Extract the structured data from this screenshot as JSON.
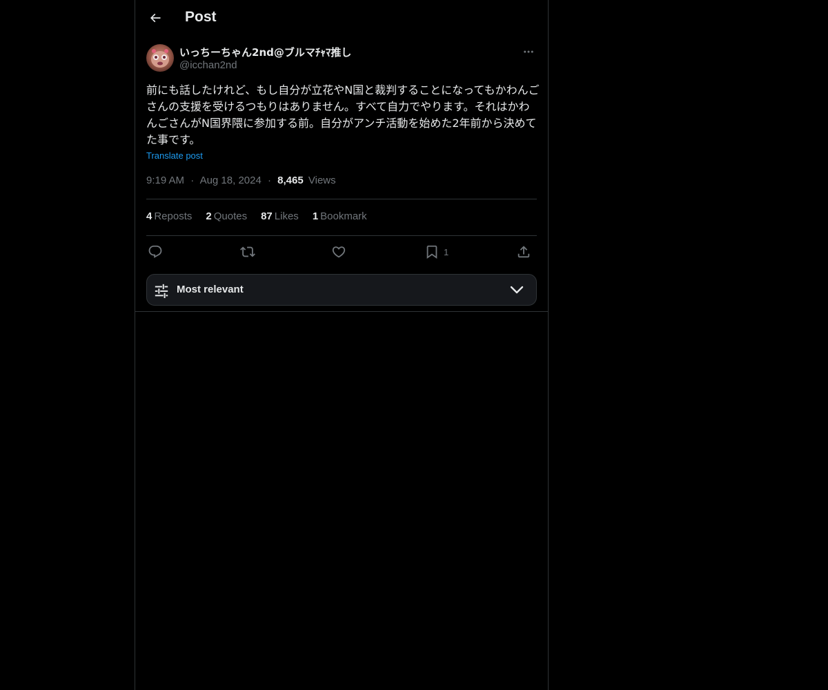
{
  "header": {
    "title": "Post",
    "back_icon": "arrow-left-icon"
  },
  "author": {
    "display_name": "いっちーちゃん2nd@ブルマﾁｬﾏ推し",
    "handle": "@icchan2nd",
    "avatar_icon": "avatar",
    "more_icon": "more-horizontal-icon"
  },
  "post": {
    "text": "前にも話したけれど、もし自分が立花やN国と裁判することになってもかわんごさんの支援を受けるつもりはありません。すべて自力でやります。それはかわんごさんがN国界隈に参加する前。自分がアンチ活動を始めた2年前から決めてた事です。",
    "translate_label": "Translate post",
    "time": "9:19 AM",
    "separator": "·",
    "date": "Aug 18, 2024",
    "views_count": "8,465",
    "views_label": "Views"
  },
  "stats": [
    {
      "count": "4",
      "label": "Reposts"
    },
    {
      "count": "2",
      "label": "Quotes"
    },
    {
      "count": "87",
      "label": "Likes"
    },
    {
      "count": "1",
      "label": "Bookmark"
    }
  ],
  "actions": {
    "reply_icon": "reply-icon",
    "repost_icon": "repost-icon",
    "like_icon": "heart-icon",
    "bookmark_icon": "bookmark-icon",
    "bookmark_count": "1",
    "share_icon": "share-icon"
  },
  "sort": {
    "label": "Most relevant",
    "icon": "sliders-icon",
    "chevron": "chevron-down-icon"
  },
  "colors": {
    "background": "#000000",
    "text": "#e7e9ea",
    "muted": "#71767b",
    "link": "#1d9bf0",
    "border": "#2f3336"
  }
}
